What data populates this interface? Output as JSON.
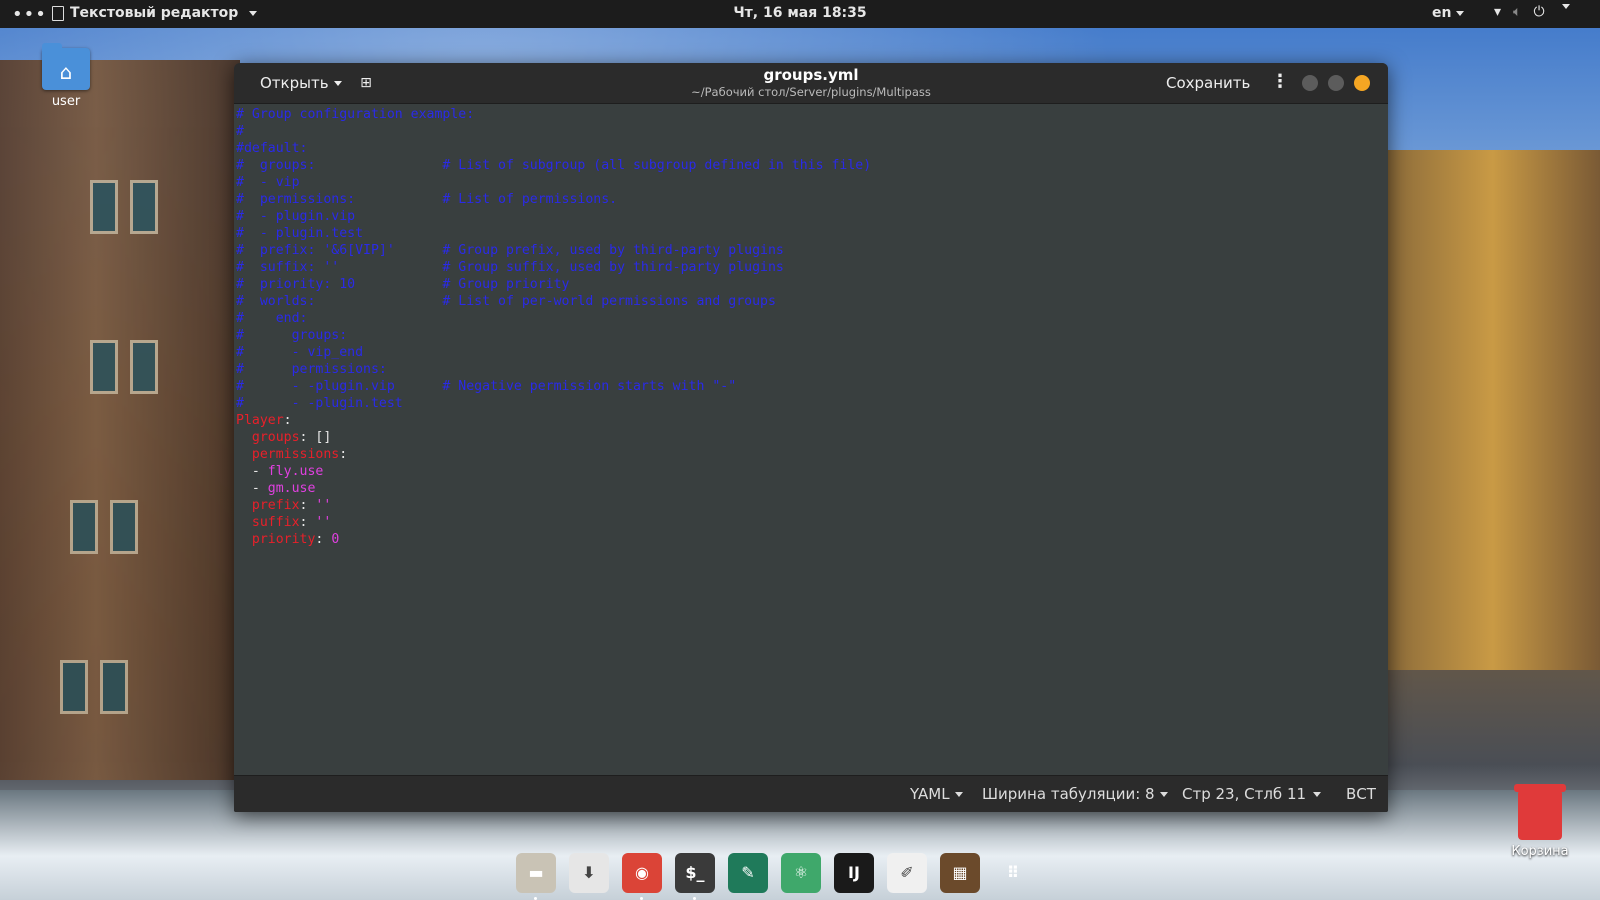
{
  "topbar": {
    "app_name": "Текстовый редактор",
    "clock": "Чт, 16 мая 18:35",
    "lang": "en"
  },
  "desktop": {
    "home_label": "user",
    "trash_label": "Корзина"
  },
  "window": {
    "open_label": "Открыть",
    "title": "groups.yml",
    "subtitle": "~/Рабочий стол/Server/plugins/Multipass",
    "save_label": "Сохранить"
  },
  "editor": {
    "lines": [
      [
        [
          "c-com",
          "# Group configuration example:"
        ]
      ],
      [
        [
          "c-com",
          "#"
        ]
      ],
      [
        [
          "c-com",
          "#default:"
        ]
      ],
      [
        [
          "c-com",
          "#  groups:                # List of subgroup (all subgroup defined in this file)"
        ]
      ],
      [
        [
          "c-com",
          "#  - vip"
        ]
      ],
      [
        [
          "c-com",
          "#  permissions:           # List of permissions."
        ]
      ],
      [
        [
          "c-com",
          "#  - plugin.vip"
        ]
      ],
      [
        [
          "c-com",
          "#  - plugin.test"
        ]
      ],
      [
        [
          "c-com",
          "#  prefix: '&6[VIP]'      # Group prefix, used by third-party plugins"
        ]
      ],
      [
        [
          "c-com",
          "#  suffix: ''             # Group suffix, used by third-party plugins"
        ]
      ],
      [
        [
          "c-com",
          "#  priority: 10           # Group priority"
        ]
      ],
      [
        [
          "c-com",
          "#  worlds:                # List of per-world permissions and groups"
        ]
      ],
      [
        [
          "c-com",
          "#    end:"
        ]
      ],
      [
        [
          "c-com",
          "#      groups:"
        ]
      ],
      [
        [
          "c-com",
          "#      - vip_end"
        ]
      ],
      [
        [
          "c-com",
          "#      permissions:"
        ]
      ],
      [
        [
          "c-com",
          "#      - -plugin.vip      # Negative permission starts with \"-\""
        ]
      ],
      [
        [
          "c-com",
          "#      - -plugin.test"
        ]
      ],
      [
        [
          "c-key",
          "Player"
        ],
        [
          "c-pun",
          ":"
        ]
      ],
      [
        [
          "c-pun",
          "  "
        ],
        [
          "c-key",
          "groups"
        ],
        [
          "c-pun",
          ": []"
        ]
      ],
      [
        [
          "c-pun",
          "  "
        ],
        [
          "c-key",
          "permissions"
        ],
        [
          "c-pun",
          ":"
        ]
      ],
      [
        [
          "c-pun",
          "  - "
        ],
        [
          "c-str",
          "fly.use"
        ]
      ],
      [
        [
          "c-pun",
          "  - "
        ],
        [
          "c-str",
          "gm.use"
        ]
      ],
      [
        [
          "c-pun",
          "  "
        ],
        [
          "c-key",
          "prefix"
        ],
        [
          "c-pun",
          ": "
        ],
        [
          "c-str",
          "''"
        ]
      ],
      [
        [
          "c-pun",
          "  "
        ],
        [
          "c-key",
          "suffix"
        ],
        [
          "c-pun",
          ": "
        ],
        [
          "c-str",
          "''"
        ]
      ],
      [
        [
          "c-pun",
          "  "
        ],
        [
          "c-key",
          "priority"
        ],
        [
          "c-pun",
          ": "
        ],
        [
          "c-num",
          "0"
        ]
      ]
    ]
  },
  "statusbar": {
    "language": "YAML",
    "tab_width": "Ширина табуляции: 8",
    "position": "Стр 23, Стлб 11",
    "mode": "ВСТ"
  },
  "dock": {
    "apps": [
      {
        "icon": "files-icon",
        "color": "#c9c3b5",
        "glyph": "▬"
      },
      {
        "icon": "software-center-icon",
        "color": "#e6e6e6",
        "glyph": "⬇"
      },
      {
        "icon": "chrome-icon",
        "color": "#db4437",
        "glyph": "◉"
      },
      {
        "icon": "terminal-icon",
        "color": "#3a3a3a",
        "glyph": "$_"
      },
      {
        "icon": "wrench-icon",
        "color": "#1f7a5a",
        "glyph": "✎"
      },
      {
        "icon": "atom-icon",
        "color": "#3fa86b",
        "glyph": "⚛"
      },
      {
        "icon": "intellij-icon",
        "color": "#1a1a1a",
        "glyph": "IJ"
      },
      {
        "icon": "text-editor-icon",
        "color": "#f0f0f0",
        "glyph": "✐"
      },
      {
        "icon": "minecraft-icon",
        "color": "#6b4a2b",
        "glyph": "▦"
      },
      {
        "icon": "app-grid-icon",
        "color": "transparent",
        "glyph": "⠿"
      }
    ]
  }
}
